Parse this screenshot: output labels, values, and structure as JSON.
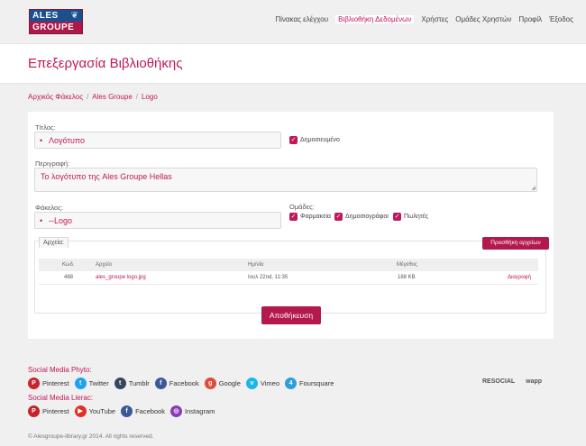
{
  "header": {
    "logo_top": "ALES",
    "logo_bottom": "GROUPE",
    "nav": [
      "Πίνακας ελέγχου",
      "Βιβλιοθήκη Δεδομένων",
      "Χρήστες",
      "Ομάδες Χρηστών",
      "Προφίλ",
      "Έξοδος"
    ],
    "active_nav": "Βιβλιοθήκη Δεδομένων"
  },
  "page_title": "Επεξεργασία Βιβλιοθήκης",
  "breadcrumb": [
    "Αρχικός Φάκελος",
    "Ales Groupe",
    "Logo"
  ],
  "form": {
    "title_label": "Τίτλος:",
    "title_value": "Λογότυπο",
    "published_label": "Δημοσιευμένο",
    "description_label": "Περιγραφή:",
    "description_value": "Το λογότυπο της Ales Groupe Hellas",
    "folder_label": "Φάκελος:",
    "folder_value": "--Logo",
    "groups_label": "Ομάδες:",
    "groups": [
      "Φαρμακεία",
      "Δημοσιογράφοι",
      "Πωλητές"
    ]
  },
  "files": {
    "tab_label": "Αρχεία:",
    "add_button": "Προσθήκη αρχείων",
    "columns": [
      "Κωδ.",
      "Αρχείο",
      "Ημ/νία",
      "Μέγεθος"
    ],
    "rows": [
      {
        "id": "488",
        "file": "ales_groupe logo.jpg",
        "date": "Ιουλ 22nd, 11:35",
        "size": "188 KB",
        "action": "Διαγραφή"
      }
    ]
  },
  "save_button": "Αποθήκευση",
  "social": {
    "phyto_title": "Social Media Phyto:",
    "phyto": [
      {
        "label": "Pinterest",
        "icon": "pinterest-icon",
        "color": "#c8232c",
        "glyph": "P"
      },
      {
        "label": "Twitter",
        "icon": "twitter-icon",
        "color": "#1da1f2",
        "glyph": "t"
      },
      {
        "label": "Tumblr",
        "icon": "tumblr-icon",
        "color": "#36465d",
        "glyph": "t"
      },
      {
        "label": "Facebook",
        "icon": "facebook-icon",
        "color": "#3b5998",
        "glyph": "f"
      },
      {
        "label": "Google",
        "icon": "google-icon",
        "color": "#dd4b39",
        "glyph": "g+"
      },
      {
        "label": "Vimeo",
        "icon": "vimeo-icon",
        "color": "#1ab7ea",
        "glyph": "v"
      },
      {
        "label": "Foursquare",
        "icon": "foursquare-icon",
        "color": "#2d9fd9",
        "glyph": "4"
      }
    ],
    "lierac_title": "Social Media Lierac:",
    "lierac": [
      {
        "label": "Pinterest",
        "icon": "pinterest-icon",
        "color": "#c8232c",
        "glyph": "P"
      },
      {
        "label": "YouTube",
        "icon": "youtube-icon",
        "color": "#e52d27",
        "glyph": "▶"
      },
      {
        "label": "Facebook",
        "icon": "facebook-icon",
        "color": "#3b5998",
        "glyph": "f"
      },
      {
        "label": "Instagram",
        "icon": "instagram-icon",
        "color": "#8a3ab9",
        "glyph": "◎"
      }
    ]
  },
  "partners": [
    "RESOCIAL",
    "wapp"
  ],
  "footer": "© Alesgroupe-library.gr 2014. All rights reserved.",
  "colors": {
    "accent": "#c0185a",
    "button": "#b3194d"
  }
}
